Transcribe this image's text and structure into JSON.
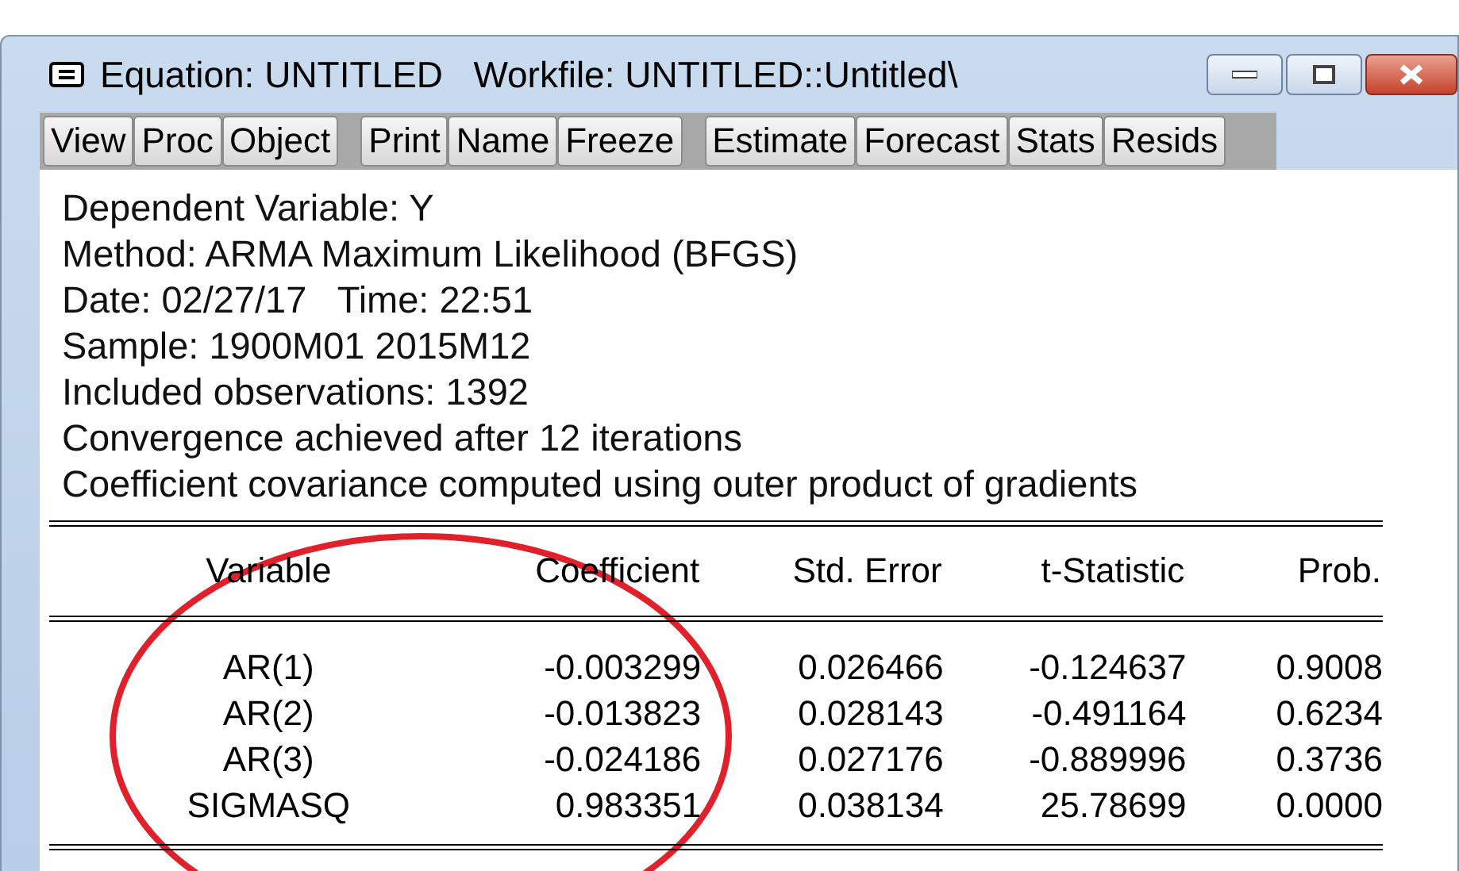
{
  "window": {
    "title": "Equation: UNTITLED   Workfile: UNTITLED::Untitled\\"
  },
  "toolbar": {
    "groups": [
      [
        "View",
        "Proc",
        "Object"
      ],
      [
        "Print",
        "Name",
        "Freeze"
      ],
      [
        "Estimate",
        "Forecast",
        "Stats",
        "Resids"
      ]
    ]
  },
  "output": {
    "lines": [
      "Dependent Variable: Y",
      "Method: ARMA Maximum Likelihood (BFGS)",
      "Date: 02/27/17   Time: 22:51",
      "Sample: 1900M01 2015M12",
      "Included observations: 1392",
      "Convergence achieved after 12 iterations",
      "Coefficient covariance computed using outer product of gradients"
    ]
  },
  "table": {
    "columns": [
      "Variable",
      "Coefficient",
      "Std. Error",
      "t-Statistic",
      "Prob."
    ],
    "rows": [
      [
        "AR(1)",
        "-0.003299",
        "0.026466",
        "-0.124637",
        "0.9008"
      ],
      [
        "AR(2)",
        "-0.013823",
        "0.028143",
        "-0.491164",
        "0.6234"
      ],
      [
        "AR(3)",
        "-0.024186",
        "0.027176",
        "-0.889996",
        "0.3736"
      ],
      [
        "SIGMASQ",
        "0.983351",
        "0.038134",
        "25.78699",
        "0.0000"
      ]
    ]
  }
}
